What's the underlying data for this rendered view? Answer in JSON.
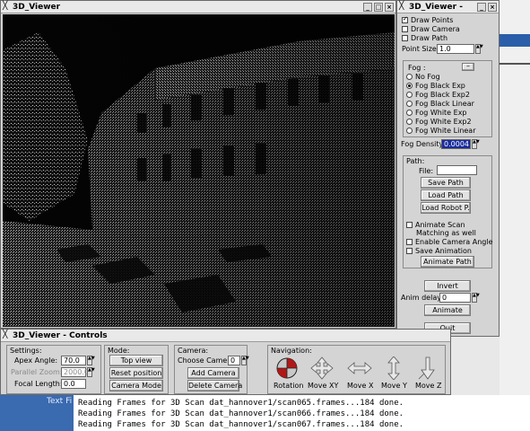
{
  "viewer": {
    "title": "3D_Viewer"
  },
  "panel": {
    "title": "3D_Viewer -",
    "checks": [
      {
        "label": "Draw Points",
        "checked": true
      },
      {
        "label": "Draw Camera",
        "checked": false
      },
      {
        "label": "Draw Path",
        "checked": false
      }
    ],
    "point_size_label": "Point Size:",
    "point_size_value": "1.0",
    "fog_label": "Fog :",
    "fog_options": [
      {
        "label": "No Fog",
        "selected": false
      },
      {
        "label": "Fog Black Exp",
        "selected": true
      },
      {
        "label": "Fog Black Exp2",
        "selected": false
      },
      {
        "label": "Fog Black Linear",
        "selected": false
      },
      {
        "label": "Fog White Exp",
        "selected": false
      },
      {
        "label": "Fog White Exp2",
        "selected": false
      },
      {
        "label": "Fog White Linear",
        "selected": false
      }
    ],
    "fog_density_label": "Fog Density:",
    "fog_density_value": "0.0004",
    "path_label": "Path:",
    "file_label": "File:",
    "file_value": "",
    "save_path": "Save Path",
    "load_path": "Load Path",
    "load_robot": "Load Robot P.",
    "animate_scan": "Animate Scan",
    "matching": "Matching as well",
    "enable_camera_angle": "Enable Camera Angle",
    "save_animation": "Save Animation",
    "animate_path": "Animate Path",
    "invert": "Invert",
    "anim_delay_label": "Anim delay:",
    "anim_delay_value": "0",
    "animate": "Animate",
    "quit": "Quit"
  },
  "controls": {
    "title": "3D_Viewer - Controls",
    "settings": {
      "title": "Settings:",
      "apex_label": "Apex Angle:",
      "apex_value": "70.0",
      "parallel_label": "Parallel Zoom:",
      "parallel_value": "2000.0",
      "focal_label": "Focal Length:",
      "focal_value": "0.0"
    },
    "mode": {
      "title": "Mode:",
      "top_view": "Top view",
      "reset_position": "Reset position",
      "camera_mode": "Camera Mode"
    },
    "camera": {
      "title": "Camera:",
      "choose_label": "Choose Camera",
      "choose_value": "0",
      "add_camera": "Add Camera",
      "delete_camera": "Delete Camera"
    },
    "navigation": {
      "title": "Navigation:",
      "items": [
        {
          "label": "Rotation",
          "icon": "rotation-ball-icon"
        },
        {
          "label": "Move XY",
          "icon": "move-xy-icon"
        },
        {
          "label": "Move X",
          "icon": "move-x-icon"
        },
        {
          "label": "Move Y",
          "icon": "move-y-icon"
        },
        {
          "label": "Move Z",
          "icon": "move-z-icon"
        }
      ]
    }
  },
  "desktop": {
    "partial_label": "Text Fi",
    "terminal_lines": [
      "Reading Frames for 3D Scan dat_hannover1/scan065.frames...184 done.",
      "Reading Frames for 3D Scan dat_hannover1/scan066.frames...184 done.",
      "Reading Frames for 3D Scan dat_hannover1/scan067.frames...184 done."
    ]
  }
}
